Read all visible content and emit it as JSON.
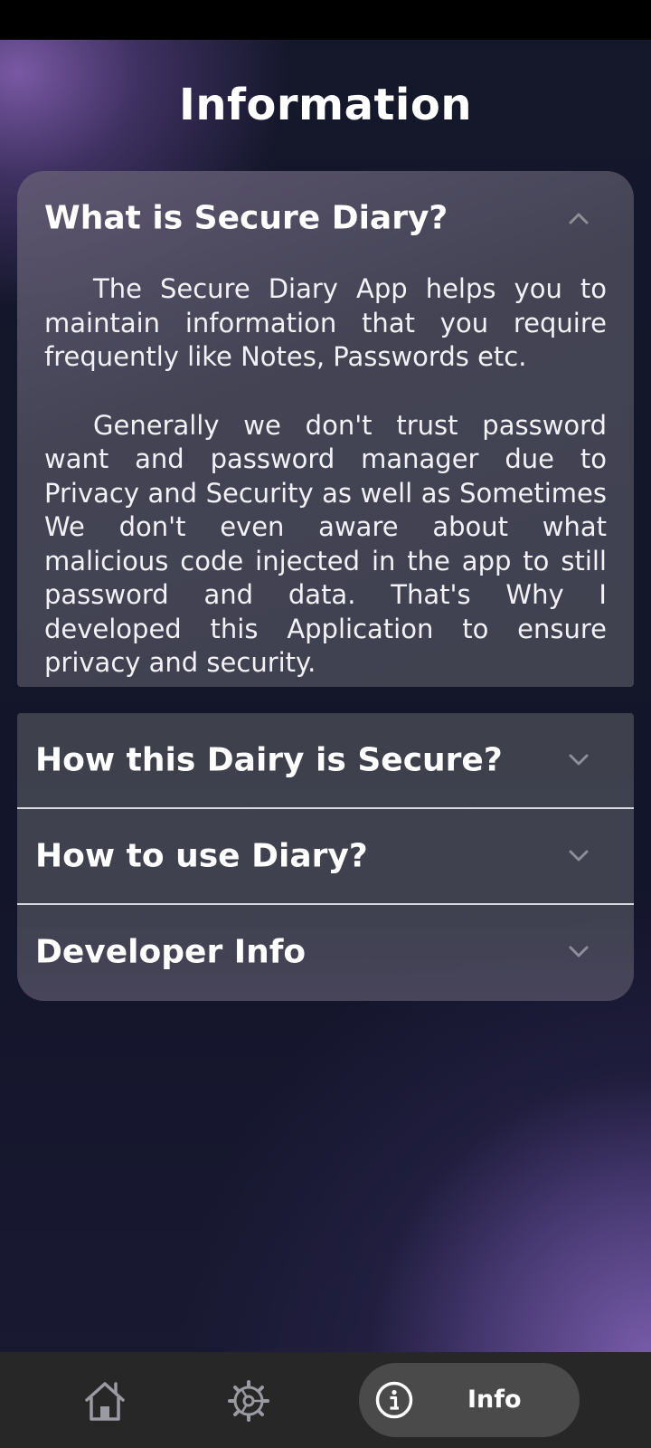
{
  "page": {
    "title": "Information"
  },
  "accordion": {
    "items": [
      {
        "title": "What is Secure Diary?",
        "expanded": true,
        "icon": "chevron-up-icon",
        "paragraphs": [
          "The Secure Diary App helps you to maintain information that you require frequently like Notes, Passwords etc.",
          "Generally we don't trust password want and password manager due to Privacy and Security as well as Sometimes We don't even aware about what malicious code injected in the app to still password and data. That's Why I developed this Application to ensure privacy and security."
        ]
      },
      {
        "title": "How this Dairy is Secure?",
        "expanded": false,
        "icon": "chevron-down-icon"
      },
      {
        "title": "How to use Diary?",
        "expanded": false,
        "icon": "chevron-down-icon"
      },
      {
        "title": "Developer Info",
        "expanded": false,
        "icon": "chevron-down-icon"
      }
    ]
  },
  "bottom_nav": {
    "items": [
      {
        "icon": "home-icon",
        "label": ""
      },
      {
        "icon": "gear-icon",
        "label": ""
      },
      {
        "icon": "info-icon",
        "label": "Info",
        "active": true
      }
    ]
  },
  "colors": {
    "background": "#14162a",
    "accent_purple": "#7e5caa",
    "panel": "#464856",
    "nav_bar": "#272727",
    "nav_active_pill": "#4a4a4a",
    "text": "#ffffff",
    "icon_muted": "#9a9aa2"
  }
}
